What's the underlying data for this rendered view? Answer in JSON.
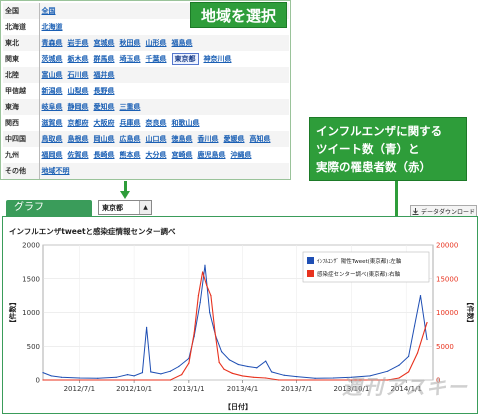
{
  "regions": [
    {
      "name": "全国",
      "prefs": [
        "全国"
      ]
    },
    {
      "name": "北海道",
      "prefs": [
        "北海道"
      ]
    },
    {
      "name": "東北",
      "prefs": [
        "青森県",
        "岩手県",
        "宮城県",
        "秋田県",
        "山形県",
        "福島県"
      ]
    },
    {
      "name": "関東",
      "prefs": [
        "茨城県",
        "栃木県",
        "群馬県",
        "埼玉県",
        "千葉県",
        "東京都",
        "神奈川県"
      ]
    },
    {
      "name": "北陸",
      "prefs": [
        "富山県",
        "石川県",
        "福井県"
      ]
    },
    {
      "name": "甲信越",
      "prefs": [
        "新潟県",
        "山梨県",
        "長野県"
      ]
    },
    {
      "name": "東海",
      "prefs": [
        "岐阜県",
        "静岡県",
        "愛知県",
        "三重県"
      ]
    },
    {
      "name": "関西",
      "prefs": [
        "滋賀県",
        "京都府",
        "大阪府",
        "兵庫県",
        "奈良県",
        "和歌山県"
      ]
    },
    {
      "name": "中四国",
      "prefs": [
        "鳥取県",
        "島根県",
        "岡山県",
        "広島県",
        "山口県",
        "徳島県",
        "香川県",
        "愛媛県",
        "高知県"
      ]
    },
    {
      "name": "九州",
      "prefs": [
        "福岡県",
        "佐賀県",
        "長崎県",
        "熊本県",
        "大分県",
        "宮崎県",
        "鹿児島県",
        "沖縄県"
      ]
    },
    {
      "name": "その他",
      "prefs": [
        "地域不明"
      ]
    }
  ],
  "selected_pref": "東京都",
  "callouts": {
    "region": "地域を選択",
    "twitter_lines": [
      "インフルエンザに関する",
      "ツイート数（青）と",
      "実際の罹患者数（赤）"
    ]
  },
  "tabs": {
    "graph": "グラフ"
  },
  "region_select_value": "東京都",
  "region_select_chevron": "▲",
  "download_label": "データダウンロード",
  "download_icon": "download-icon",
  "watermark": "週刊アスキー",
  "colors": {
    "tweet_series": "#1f4fb4",
    "patient_series": "#e8321e",
    "accent_green": "#2e9d3a"
  },
  "chart_data": {
    "type": "line",
    "title": "インフルエンザtweetと感染症情報センター調べ",
    "xlabel": "【日付】",
    "ylabel_left": "【件数】",
    "ylabel_right": "【件数】",
    "x_ticks": [
      "2012/7/1",
      "2012/10/1",
      "2013/1/1",
      "2013/4/1",
      "2013/7/1",
      "2013/10/1",
      "2014/1/1"
    ],
    "y_left_ticks": [
      0,
      500,
      1000,
      1500,
      2000
    ],
    "y_right_ticks": [
      0,
      5000,
      10000,
      15000,
      20000
    ],
    "ylim_left": [
      0,
      2000
    ],
    "ylim_right": [
      0,
      20000
    ],
    "x_range": [
      "2012/5/1",
      "2014/2/15"
    ],
    "legend_position": "top-right",
    "series": [
      {
        "name": "ｲﾝﾌﾙｴﾝｻﾞ 陽性Tweet(東京都):左軸",
        "axis": "left",
        "points": [
          [
            "2012/5/1",
            110
          ],
          [
            "2012/5/15",
            60
          ],
          [
            "2012/6/1",
            40
          ],
          [
            "2012/7/1",
            30
          ],
          [
            "2012/8/1",
            25
          ],
          [
            "2012/9/1",
            40
          ],
          [
            "2012/9/20",
            80
          ],
          [
            "2012/10/1",
            60
          ],
          [
            "2012/10/15",
            110
          ],
          [
            "2012/10/22",
            780
          ],
          [
            "2012/10/29",
            120
          ],
          [
            "2012/11/15",
            90
          ],
          [
            "2012/12/1",
            130
          ],
          [
            "2012/12/15",
            200
          ],
          [
            "2013/1/1",
            320
          ],
          [
            "2013/1/10",
            650
          ],
          [
            "2013/1/20",
            1150
          ],
          [
            "2013/1/28",
            1700
          ],
          [
            "2013/2/5",
            1000
          ],
          [
            "2013/2/15",
            650
          ],
          [
            "2013/2/25",
            420
          ],
          [
            "2013/3/10",
            300
          ],
          [
            "2013/3/25",
            230
          ],
          [
            "2013/4/10",
            200
          ],
          [
            "2013/4/25",
            180
          ],
          [
            "2013/5/10",
            280
          ],
          [
            "2013/5/20",
            120
          ],
          [
            "2013/6/10",
            70
          ],
          [
            "2013/7/1",
            50
          ],
          [
            "2013/8/1",
            25
          ],
          [
            "2013/9/1",
            30
          ],
          [
            "2013/10/1",
            40
          ],
          [
            "2013/11/1",
            60
          ],
          [
            "2013/12/1",
            130
          ],
          [
            "2013/12/20",
            220
          ],
          [
            "2014/1/5",
            350
          ],
          [
            "2014/1/15",
            800
          ],
          [
            "2014/1/25",
            1250
          ],
          [
            "2014/2/5",
            600
          ]
        ]
      },
      {
        "name": "感染症センター調べ(東京都):右軸",
        "axis": "right",
        "points": [
          [
            "2012/5/1",
            0
          ],
          [
            "2012/12/1",
            0
          ],
          [
            "2012/12/20",
            800
          ],
          [
            "2013/1/1",
            2500
          ],
          [
            "2013/1/10",
            7000
          ],
          [
            "2013/1/17",
            12500
          ],
          [
            "2013/1/24",
            16000
          ],
          [
            "2013/1/31",
            14000
          ],
          [
            "2013/2/7",
            12500
          ],
          [
            "2013/2/14",
            7000
          ],
          [
            "2013/2/21",
            2600
          ],
          [
            "2013/3/1",
            1600
          ],
          [
            "2013/3/15",
            1000
          ],
          [
            "2013/4/1",
            600
          ],
          [
            "2013/4/20",
            400
          ],
          [
            "2013/5/10",
            300
          ],
          [
            "2013/6/1",
            0
          ],
          [
            "2013/12/1",
            0
          ],
          [
            "2013/12/20",
            300
          ],
          [
            "2014/1/5",
            1200
          ],
          [
            "2014/1/20",
            4000
          ],
          [
            "2014/2/5",
            8500
          ]
        ]
      }
    ]
  }
}
